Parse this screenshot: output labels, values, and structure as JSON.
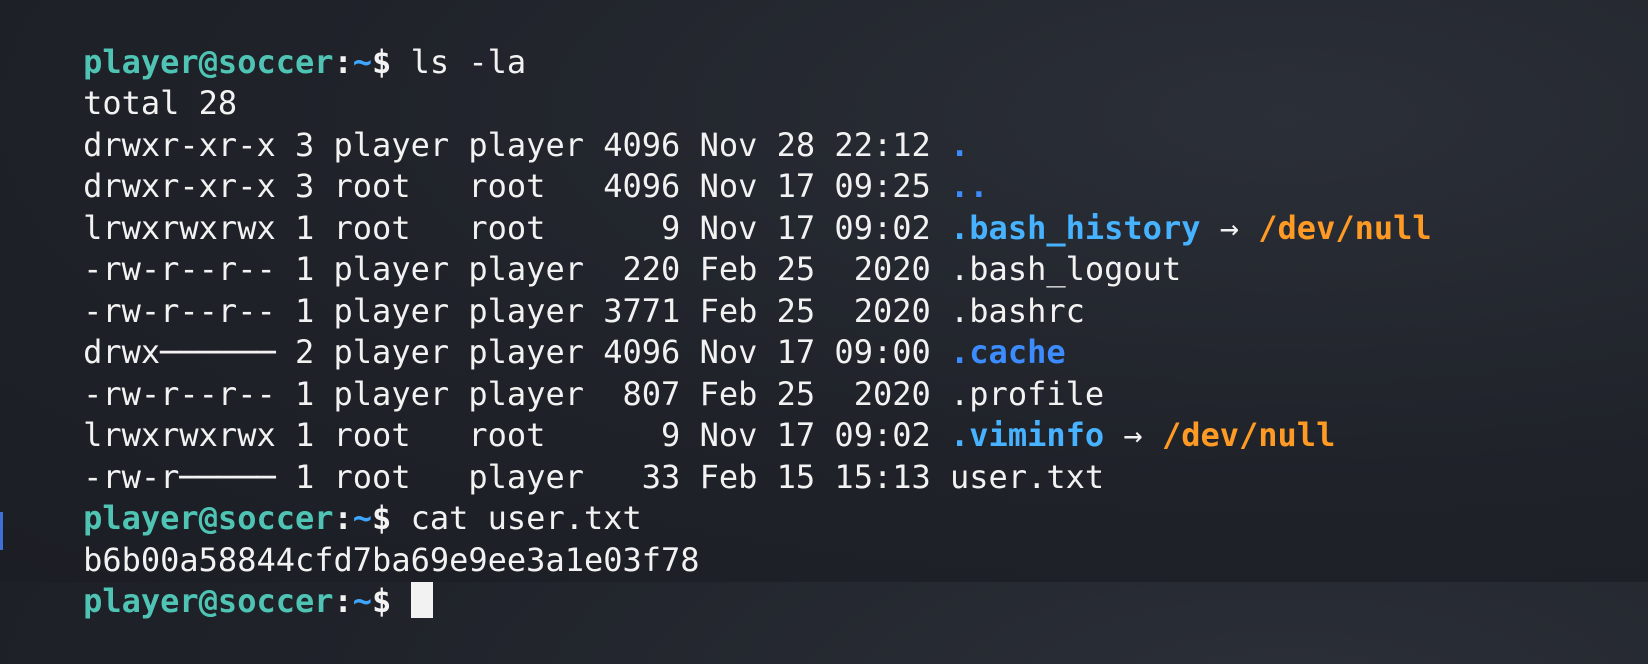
{
  "prompt": {
    "user_host": "player@soccer",
    "colon": ":",
    "path": "~",
    "symbol": "$ "
  },
  "lines": [
    {
      "type": "prompt",
      "command": "ls -la"
    },
    {
      "type": "text",
      "text": "total 28"
    },
    {
      "type": "entry",
      "meta": "drwxr-xr-x 3 player player 4096 Nov 28 22:12 ",
      "name": ".",
      "kind": "dir"
    },
    {
      "type": "entry",
      "meta": "drwxr-xr-x 3 root   root   4096 Nov 17 09:25 ",
      "name": "..",
      "kind": "dir"
    },
    {
      "type": "entry",
      "meta": "lrwxrwxrwx 1 root   root      9 Nov 17 09:02 ",
      "name": ".bash_history",
      "kind": "link",
      "arrow": " → ",
      "target": "/dev/null"
    },
    {
      "type": "entry",
      "meta": "-rw-r--r-- 1 player player  220 Feb 25  2020 ",
      "name": ".bash_logout",
      "kind": "file"
    },
    {
      "type": "entry",
      "meta": "-rw-r--r-- 1 player player 3771 Feb 25  2020 ",
      "name": ".bashrc",
      "kind": "file"
    },
    {
      "type": "entry",
      "meta": "drwx────── 2 player player 4096 Nov 17 09:00 ",
      "name": ".cache",
      "kind": "dir"
    },
    {
      "type": "entry",
      "meta": "-rw-r--r-- 1 player player  807 Feb 25  2020 ",
      "name": ".profile",
      "kind": "file"
    },
    {
      "type": "entry",
      "meta": "lrwxrwxrwx 1 root   root      9 Nov 17 09:02 ",
      "name": ".viminfo",
      "kind": "link",
      "arrow": " → ",
      "target": "/dev/null"
    },
    {
      "type": "entry",
      "meta": "-rw-r───── 1 root   player   33 Feb 15 15:13 ",
      "name": "user.txt",
      "kind": "file"
    },
    {
      "type": "prompt",
      "command": "cat user.txt"
    },
    {
      "type": "text",
      "text": "b6b00a58844cfd7ba69e9ee3a1e03f78"
    },
    {
      "type": "prompt",
      "command": "",
      "cursor": true
    }
  ],
  "colors": {
    "background": "#1f2229",
    "user_host": "#4fc4b4",
    "path": "#3ea6ff",
    "directory": "#3d8cff",
    "symlink": "#47b2ff",
    "symlink_target": "#ff9a24",
    "text": "#f2f2f2"
  }
}
